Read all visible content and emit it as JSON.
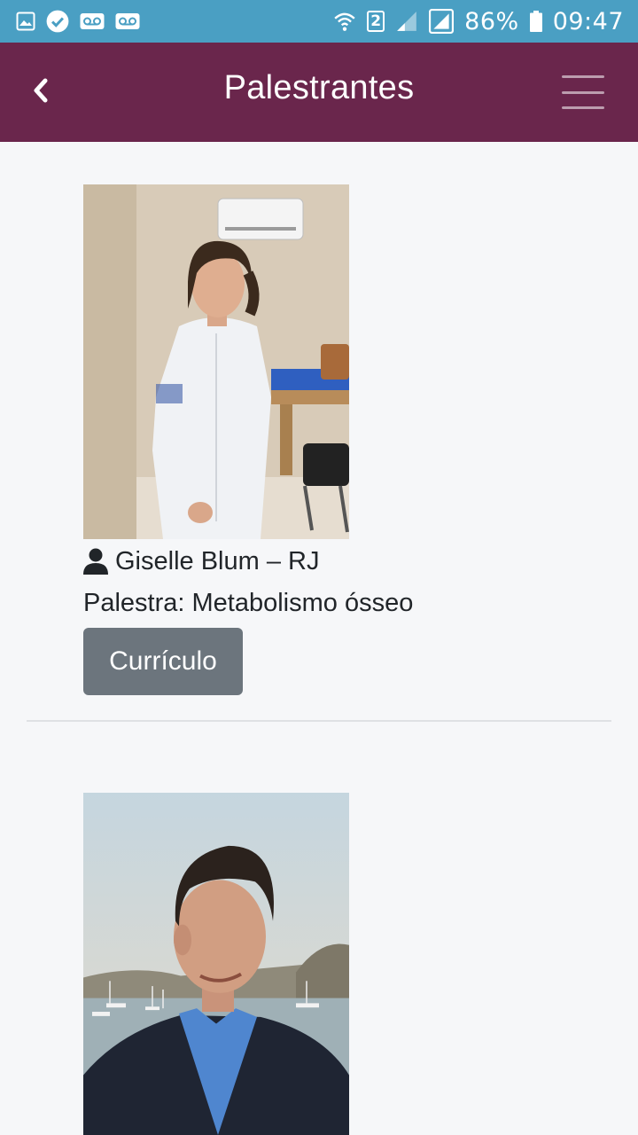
{
  "status_bar": {
    "battery": "86%",
    "time": "09:47",
    "sim": "2"
  },
  "header": {
    "title": "Palestrantes",
    "back_icon": "chevron-left-icon",
    "menu_icon": "hamburger-menu-icon"
  },
  "speakers": [
    {
      "name": "Giselle Blum – RJ",
      "talk": "Palestra: Metabolismo ósseo",
      "button": "Currículo"
    },
    {
      "name": "",
      "talk": "",
      "button": ""
    }
  ],
  "colors": {
    "status_bar": "#4a9fc3",
    "header": "#6a264c",
    "button": "#6c757d",
    "background": "#f6f7f9"
  }
}
